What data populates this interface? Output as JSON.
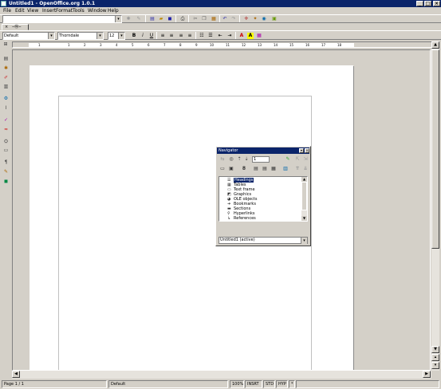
{
  "window": {
    "title": "Untitled1 - OpenOffice.org 1.0.1"
  },
  "menu": [
    "File",
    "Edit",
    "View",
    "Insert",
    "Format",
    "Tools",
    "Window",
    "Help"
  ],
  "formatting": {
    "style_value": "Default",
    "font_value": "Thorndale",
    "size_value": "12",
    "bold": "B",
    "italic": "i",
    "underline": "U"
  },
  "ruler": {
    "labels": [
      "1",
      "1",
      "2",
      "3",
      "4",
      "5",
      "6",
      "7",
      "8",
      "9",
      "10",
      "11",
      "12",
      "13",
      "14",
      "15",
      "16",
      "17",
      "18"
    ]
  },
  "navigator": {
    "title": "Navigator",
    "page_number": "1",
    "items": [
      {
        "label": "Headings",
        "icon": "heading-icon"
      },
      {
        "label": "Tables",
        "icon": "table-icon"
      },
      {
        "label": "Text frame",
        "icon": "text-frame-icon"
      },
      {
        "label": "Graphics",
        "icon": "graphics-icon"
      },
      {
        "label": "OLE objects",
        "icon": "ole-icon"
      },
      {
        "label": "Bookmarks",
        "icon": "bookmark-icon"
      },
      {
        "label": "Sections",
        "icon": "section-icon"
      },
      {
        "label": "Hyperlinks",
        "icon": "hyperlink-icon"
      },
      {
        "label": "References",
        "icon": "reference-icon"
      }
    ],
    "document": "Untitled1 (active)"
  },
  "status": {
    "page": "Page 1 / 1",
    "style": "Default",
    "zoom": "100%",
    "insert": "INSRT",
    "std": "STD",
    "hyp": "HYP",
    "star": "*"
  }
}
